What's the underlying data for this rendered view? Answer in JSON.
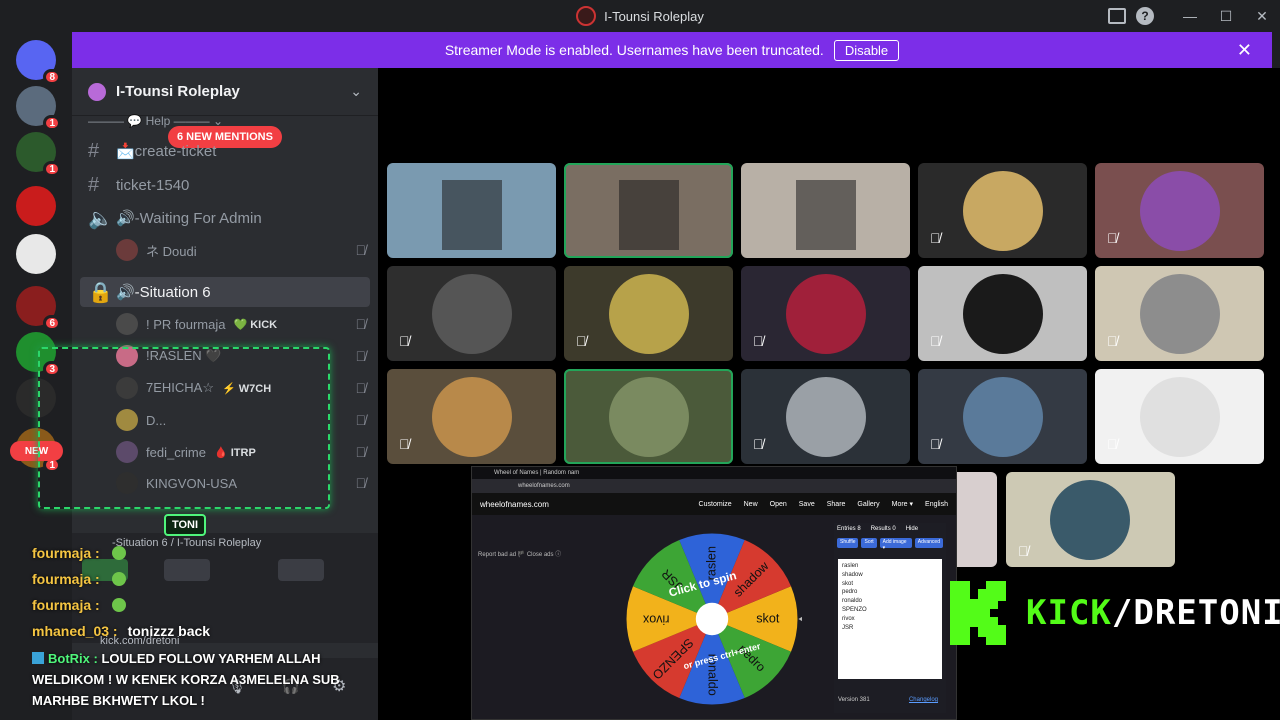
{
  "window": {
    "title": "I-Tounsi Roleplay",
    "controls": [
      "inbox-icon",
      "help-icon",
      "minimize-icon",
      "maximize-icon",
      "close-icon"
    ]
  },
  "banner": {
    "text": "Streamer Mode is enabled. Usernames have been truncated.",
    "button": "Disable",
    "bg": "#7c2ee8"
  },
  "rail": {
    "servers": [
      {
        "badge": "8",
        "color": "#5865f2"
      },
      {
        "badge": "1",
        "color": "#5b6b7d"
      },
      {
        "badge": "1",
        "color": "#2c5a2c"
      },
      {
        "badge": "",
        "color": "#c91c1c"
      },
      {
        "badge": "",
        "color": "#e8e8e8"
      },
      {
        "badge": "6",
        "color": "#8a1e1e"
      },
      {
        "badge": "3",
        "color": "#1f8f2e"
      },
      {
        "badge": "",
        "color": "#2a2a2a"
      },
      {
        "badge": "1",
        "color": "#8a5a1a"
      }
    ],
    "new_label": "NEW"
  },
  "sidebar": {
    "server_name": "I-Tounsi Roleplay",
    "help_label": "——— 💬 Help ——— ⌄",
    "mentions": "6 NEW MENTIONS",
    "channels": [
      {
        "type": "text",
        "name": "📩create-ticket"
      },
      {
        "type": "text",
        "name": "ticket-1540"
      },
      {
        "type": "voice",
        "name": "🔊-Waiting For Admin"
      }
    ],
    "waiting_users": [
      {
        "name": "ネ Doudi"
      }
    ],
    "active_channel": "🔊-Situation 6",
    "situation_users": [
      {
        "name": "! PR fourmaja",
        "tag": "💚 KICK"
      },
      {
        "name": "!RASLEN 🖤",
        "tag": ""
      },
      {
        "name": "7EHICHA☆",
        "tag": "⚡ W7CH"
      },
      {
        "name": "D...",
        "tag": ""
      },
      {
        "name": "fedi_crime",
        "tag": "🩸 ITRP"
      },
      {
        "name": "KINGVON-USA",
        "tag": ""
      }
    ],
    "voice_panel_title": "-Situation 6 / I-Tounsi Roleplay",
    "toni_label": "TONI"
  },
  "chat": {
    "lines": [
      {
        "nick": "fourmaja :",
        "text": ""
      },
      {
        "nick": "fourmaja :",
        "text": ""
      },
      {
        "nick": "fourmaja :",
        "text": ""
      },
      {
        "nick": "mhaned_03 :",
        "text": "tonizzz back"
      }
    ],
    "kick_url": "kick.com/dretoni",
    "bot_name": "BotRix :",
    "bot_message": "LOULED FOLLOW YARHEM ALLAH WELDIKOM ! W KENEK KORZA A3MELELNA SUB MARHBE BKHWETY LKOL !"
  },
  "stage": {
    "tiles": [
      {
        "kind": "video",
        "color": "#7a9ab0",
        "speaking": false,
        "muted": false
      },
      {
        "kind": "video",
        "color": "#7a6e62",
        "speaking": true,
        "muted": false
      },
      {
        "kind": "video",
        "color": "#b8b0a6",
        "speaking": false,
        "muted": false
      },
      {
        "kind": "avatar",
        "color": "#2a2a2a",
        "circle": "#c8a862",
        "speaking": false,
        "muted": true
      },
      {
        "kind": "avatar",
        "color": "#7a4f4f",
        "circle": "#8a4da8",
        "speaking": false,
        "muted": true
      },
      {
        "kind": "avatar",
        "color": "#2e2e2e",
        "circle": "#555555",
        "speaking": false,
        "muted": true
      },
      {
        "kind": "avatar",
        "color": "#3d3a2b",
        "circle": "#b7a24a",
        "speaking": false,
        "muted": true
      },
      {
        "kind": "avatar",
        "color": "#2a2633",
        "circle": "#a0203a",
        "speaking": false,
        "muted": true
      },
      {
        "kind": "avatar",
        "color": "#bfbfbf",
        "circle": "#1a1a1a",
        "speaking": false,
        "muted": true
      },
      {
        "kind": "avatar",
        "color": "#cfc7b3",
        "circle": "#8d8d8d",
        "speaking": false,
        "muted": true
      },
      {
        "kind": "avatar",
        "color": "#5a4e3c",
        "circle": "#b8894a",
        "speaking": false,
        "muted": true
      },
      {
        "kind": "avatar",
        "color": "#4b5a3a",
        "circle": "#7a8a60",
        "speaking": true,
        "muted": false
      },
      {
        "kind": "avatar",
        "color": "#2b3138",
        "circle": "#9aa0a6",
        "speaking": false,
        "muted": true
      },
      {
        "kind": "avatar",
        "color": "#343a44",
        "circle": "#5a7a9a",
        "speaking": false,
        "muted": true
      },
      {
        "kind": "avatar",
        "color": "#f1f1f1",
        "circle": "#e0e0e0",
        "speaking": false,
        "muted": true
      },
      {
        "kind": "avatar",
        "color": "#cdc9b4",
        "circle": "#3a5a6a",
        "speaking": false,
        "muted": true
      }
    ]
  },
  "browser": {
    "tab": "Wheel of Names | Random nam",
    "url": "wheelofnames.com",
    "brand": "wheelofnames.com",
    "menu": [
      "Customize",
      "New",
      "Open",
      "Save",
      "Share",
      "Gallery",
      "More ▾",
      "English"
    ],
    "report": "Report bad ad 🏴   Close ads ⓘ",
    "entries_tabs": [
      "Entries 8",
      "Results 0",
      "Hide"
    ],
    "entry_buttons": [
      "Shuffle",
      "Sort",
      "Add image ▾",
      "Advanced"
    ],
    "entries": [
      "raslen",
      "shadow",
      "skot",
      "pedro",
      "ronaldo",
      "SPENZO",
      "rivox",
      "JSR"
    ],
    "version": "Version 381",
    "changelog": "Changelog",
    "wheel": {
      "center_text_1": "Click to spin",
      "center_text_2": "or press ctrl+enter",
      "labels": [
        "skot",
        "pedro",
        "ronaldo",
        "SPENZO",
        "rivox",
        "JSR",
        "raslen",
        "shadow"
      ],
      "colors": [
        "#f2b21b",
        "#3da535",
        "#2e63d8",
        "#d63a2f",
        "#f2b21b",
        "#3da535",
        "#2e63d8",
        "#d63a2f"
      ]
    }
  },
  "kick": {
    "text_green": "KICK",
    "text_white": "/DRETONI",
    "color": "#53fc18"
  }
}
